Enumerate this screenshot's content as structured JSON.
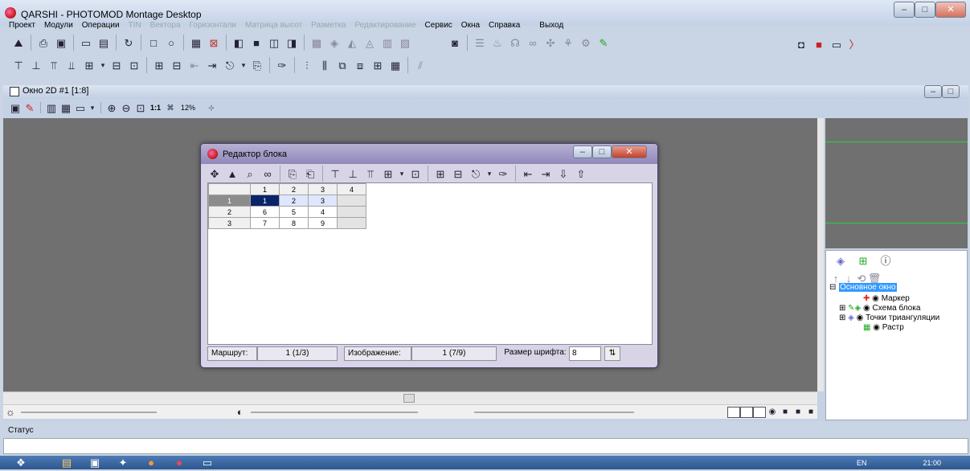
{
  "window": {
    "title": "QARSHI - PHOTOMOD Montage Desktop"
  },
  "menu": [
    {
      "label": "Проект",
      "enabled": true
    },
    {
      "label": "Модули",
      "enabled": true
    },
    {
      "label": "Операции",
      "enabled": true
    },
    {
      "label": "TIN",
      "enabled": false
    },
    {
      "label": "Вектора",
      "enabled": false
    },
    {
      "label": "Горизонтали",
      "enabled": false
    },
    {
      "label": "Матрица высот",
      "enabled": false
    },
    {
      "label": "Разметка",
      "enabled": false
    },
    {
      "label": "Редактирование",
      "enabled": false
    },
    {
      "label": "Сервис",
      "enabled": true
    },
    {
      "label": "Окна",
      "enabled": true
    },
    {
      "label": "Справка",
      "enabled": true
    },
    {
      "label": "Выход",
      "enabled": true
    }
  ],
  "doc_window": {
    "title": "Окно 2D #1 [1:8]",
    "zoom_one_to_one": "1:1",
    "zoom_percent": "12%"
  },
  "dialog": {
    "title": "Редактор блока",
    "grid": {
      "col_headers": [
        "1",
        "2",
        "3",
        "4"
      ],
      "rows": [
        {
          "label": "1",
          "cells": [
            "1",
            "2",
            "3"
          ]
        },
        {
          "label": "2",
          "cells": [
            "6",
            "5",
            "4"
          ]
        },
        {
          "label": "3",
          "cells": [
            "7",
            "8",
            "9"
          ]
        }
      ]
    },
    "status": {
      "route_label": "Маршрут:",
      "route_value": "1 (1/3)",
      "image_label": "Изображение:",
      "image_value": "1 (7/9)",
      "font_size_label": "Размер шрифта:",
      "font_size_value": "8"
    }
  },
  "layers": {
    "root": "Основное окно",
    "items": [
      "Маркер",
      "Схема блока",
      "Точки триангуляции",
      "Растр"
    ]
  },
  "status_panel": {
    "label": "Статус"
  },
  "taskbar": {
    "lang": "EN",
    "time": "21:00"
  },
  "colors": {
    "canvas": "#707070",
    "overview_lines": "#29d33a",
    "selection": "#0a246a"
  }
}
